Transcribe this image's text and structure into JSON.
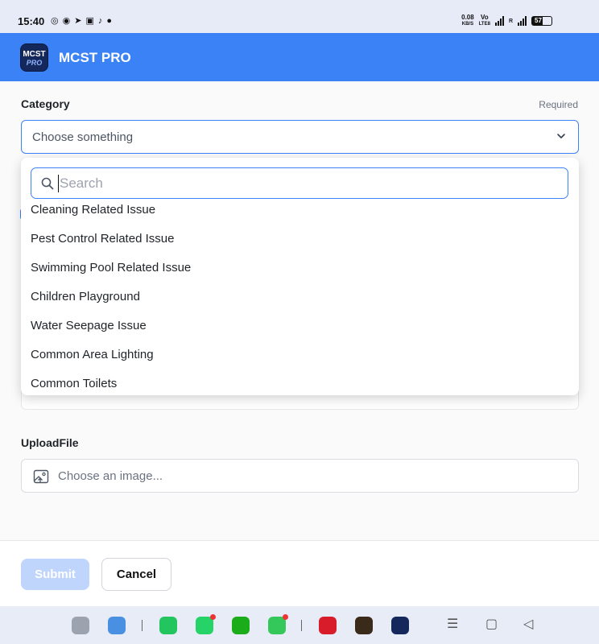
{
  "status_bar": {
    "time": "15:40",
    "notif_icons": [
      "whatsapp-icon",
      "chat-icon",
      "telegram-icon",
      "instagram-icon",
      "tiktok-icon",
      "dot-icon"
    ],
    "net_speed_value": "0.08",
    "net_speed_unit": "KB/S",
    "volte": "Vo",
    "lte": "LTE8",
    "sim_label": "R",
    "battery": "57"
  },
  "app": {
    "logo_text_top": "MCST",
    "logo_text_bottom": "PRO",
    "title": "MCST PRO",
    "brand_color": "#3b82f6"
  },
  "form": {
    "category_label": "Category",
    "required_label": "Required",
    "category_placeholder": "Choose something",
    "upload_label": "UploadFile",
    "upload_placeholder": "Choose an image..."
  },
  "dropdown": {
    "search_placeholder": "Search",
    "items": [
      "Cleaning Related Issue",
      "Pest Control Related Issue",
      "Swimming Pool Related Issue",
      "Children Playground",
      "Water Seepage Issue",
      "Common Area Lighting",
      "Common Toilets"
    ]
  },
  "footer": {
    "submit_label": "Submit",
    "cancel_label": "Cancel"
  },
  "dock": {
    "apps": [
      "app-drawer-icon",
      "wallet-icon",
      "phone-icon",
      "whatsapp-icon",
      "wechat-icon",
      "messages-icon",
      "info-app-icon",
      "mcst-pro-app-icon",
      "mcst-app-icon"
    ],
    "nav": [
      "menu-nav-icon",
      "home-nav-icon",
      "back-nav-icon"
    ]
  }
}
